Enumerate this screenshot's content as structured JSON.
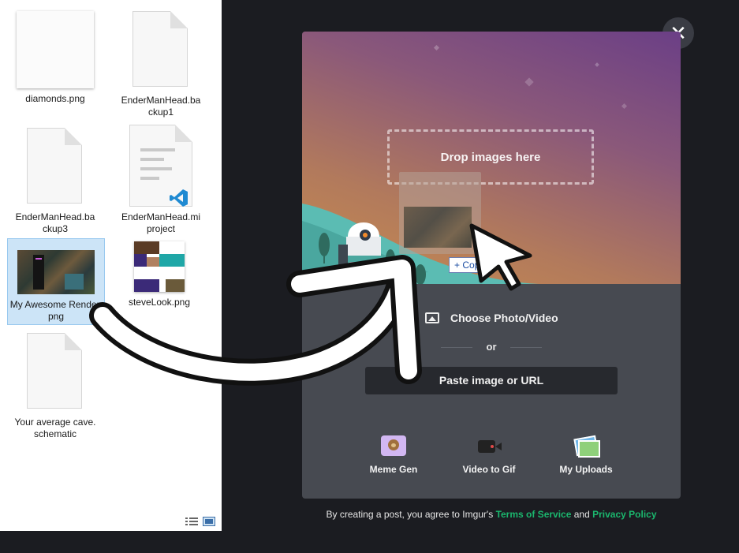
{
  "explorer": {
    "items": [
      {
        "label": "diamonds.png"
      },
      {
        "label": "EnderManHead.backup1"
      },
      {
        "label": "EnderManHead.backup3"
      },
      {
        "label": "EnderManHead.miproject"
      },
      {
        "label": "My Awesome Render.png"
      },
      {
        "label": "steveLook.png"
      },
      {
        "label": "Your average cave.schematic"
      }
    ],
    "view_icons": [
      "details-view-icon",
      "large-icons-view-icon"
    ]
  },
  "modal": {
    "close_glyph": "✕",
    "drop_text": "Drop images here",
    "copy_badge": "+ Copy",
    "choose_label": "Choose Photo/Video",
    "or_label": "or",
    "paste_label": "Paste image or URL",
    "tools": [
      {
        "label": "Meme Gen",
        "icon": "meme-gen-icon"
      },
      {
        "label": "Video to Gif",
        "icon": "video-to-gif-icon"
      },
      {
        "label": "My Uploads",
        "icon": "my-uploads-icon"
      }
    ]
  },
  "footer": {
    "prefix": "By creating a post, you agree to Imgur's",
    "terms": "Terms of Service",
    "and": "and",
    "privacy": "Privacy Policy"
  },
  "colors": {
    "link_green": "#1bb76e",
    "modal_bg": "#474a51",
    "page_bg": "#1b1c21"
  }
}
